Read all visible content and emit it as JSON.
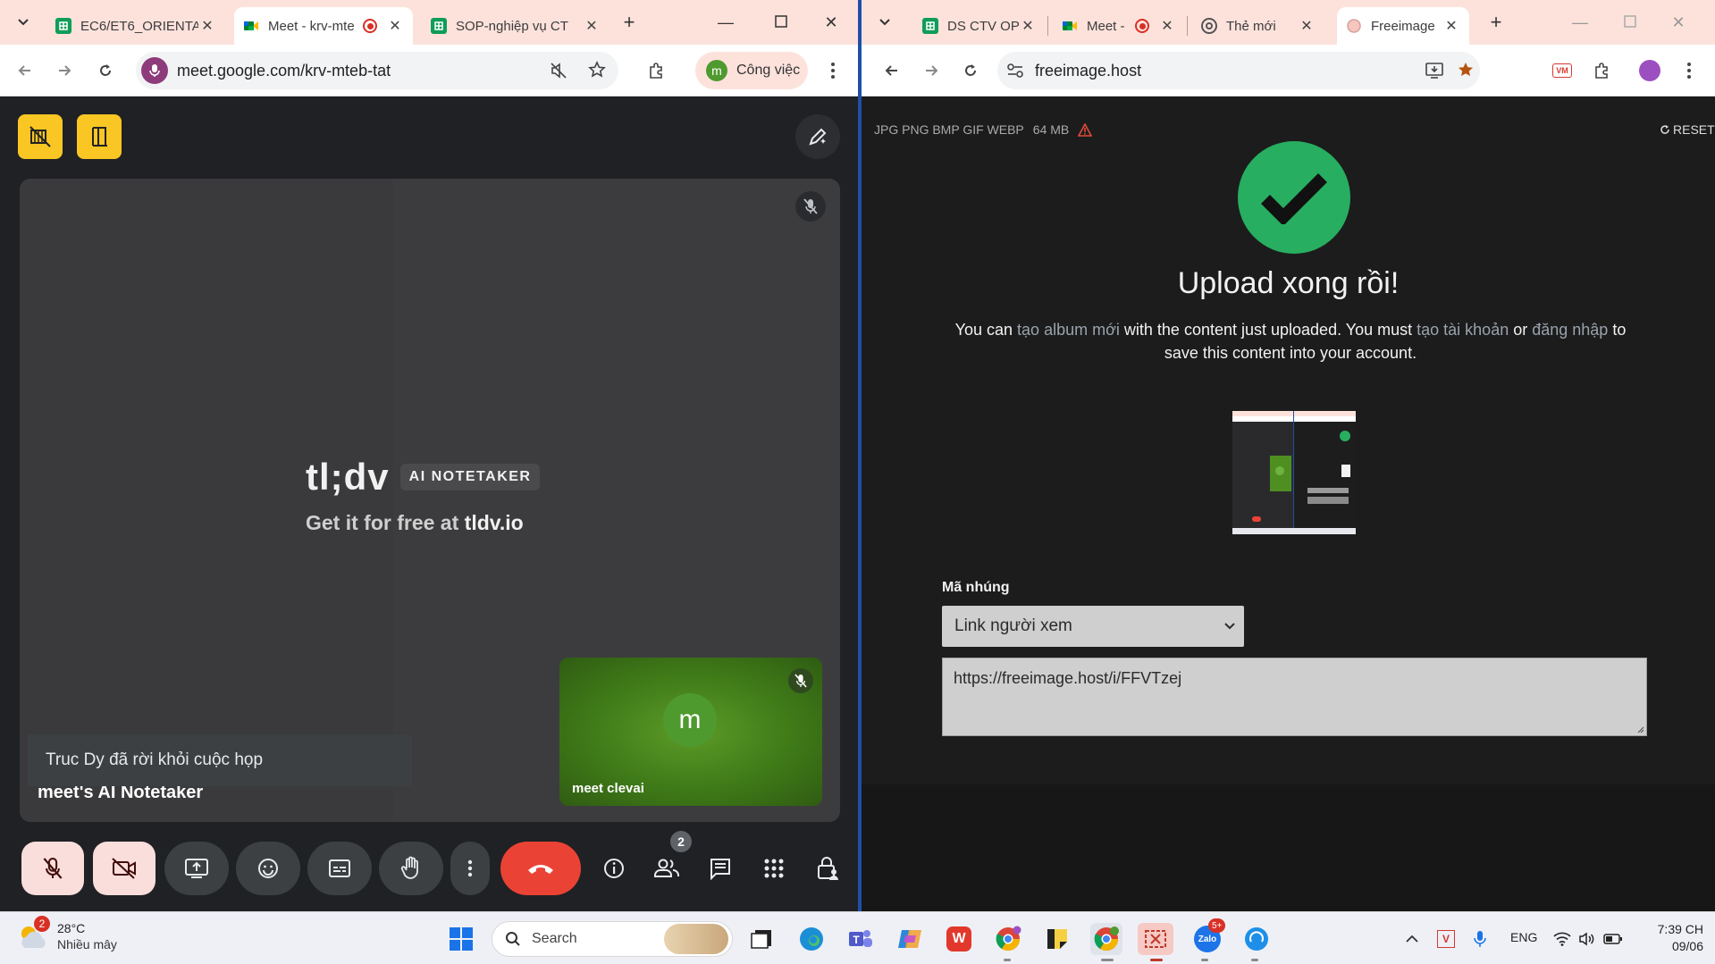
{
  "left_window": {
    "tabs": [
      {
        "title": "EC6/ET6_ORIENTA",
        "icon": "sheets-icon"
      },
      {
        "title": "Meet - krv-mte",
        "icon": "meet-icon",
        "recording": true
      },
      {
        "title": "SOP-nghiệp vụ CT",
        "icon": "sheets-icon"
      }
    ],
    "url": "meet.google.com/krv-mteb-tat",
    "profile_label": "Công việc",
    "profile_initial": "m"
  },
  "meet": {
    "tldv_logo": "tl;dv",
    "tldv_badge": "AI NOTETAKER",
    "tldv_sub_prefix": "Get it for free at ",
    "tldv_sub_link": "tldv.io",
    "toast": "Truc Dy đã rời khỏi cuộc họp",
    "main_participant": "meet's AI Notetaker",
    "self_name": "meet clevai",
    "self_initial": "m",
    "participants_count": "2",
    "colors": {
      "end_call": "#ea4335",
      "tldv_yellow": "#f9c623",
      "mic_off_bg": "#f9dedc"
    }
  },
  "right_window": {
    "tabs": [
      {
        "title": "DS CTV OP",
        "icon": "sheets-icon"
      },
      {
        "title": "Meet -",
        "icon": "meet-icon",
        "recording": true
      },
      {
        "title": "Thẻ mới",
        "icon": "chrome-icon"
      },
      {
        "title": "Freeimage",
        "icon": "freeimage-icon"
      }
    ],
    "url": "freeimage.host"
  },
  "freeimage": {
    "formats": "JPG PNG BMP GIF WEBP",
    "max_size": "64 MB",
    "reset": "RESET",
    "heading": "Upload xong rồi!",
    "msg": {
      "p1": "You can ",
      "link1": "tạo album mới",
      "p2": " with the content just uploaded. You must ",
      "link2": "tạo tài khoản",
      "p3": " or ",
      "link3": "đăng nhập",
      "p4": " to save this content into your account."
    },
    "embed_label": "Mã nhúng",
    "embed_select": "Link người xem",
    "embed_value": "https://freeimage.host/i/FFVTzej",
    "colors": {
      "success": "#27ae60"
    }
  },
  "taskbar": {
    "weather_temp": "28°C",
    "weather_desc": "Nhiều mây",
    "weather_badge": "2",
    "search_placeholder": "Search",
    "zalo_badge": "5+",
    "lang": "ENG",
    "time": "7:39 CH",
    "date": "09/06"
  }
}
